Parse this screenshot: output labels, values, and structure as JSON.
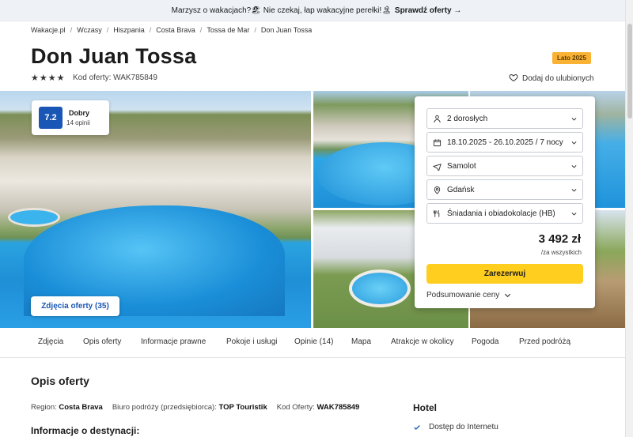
{
  "promo": {
    "text": "Marzysz o wakacjach?🏖 Nie czekaj, łap wakacyjne perełki!🏝",
    "link": "Sprawdź oferty →"
  },
  "breadcrumbs": [
    "Wakacje.pl",
    "Wczasy",
    "Hiszpania",
    "Costa Brava",
    "Tossa de Mar",
    "Don Juan Tossa"
  ],
  "offer": {
    "title": "Don Juan Tossa",
    "season_badge": "Lato 2025",
    "stars": 4,
    "code": "Kod oferty: WAK785849",
    "favorite_label": "Dodaj do ulubionych"
  },
  "rating": {
    "score": "7.2",
    "word": "Dobry",
    "count": "14 opinii"
  },
  "gallery": {
    "photos_button": "Zdjęcia oferty (35)"
  },
  "booking": {
    "guests": "2 dorosłych",
    "dates": "18.10.2025 - 26.10.2025 / 7 nocy",
    "transport": "Samolot",
    "departure": "Gdańsk",
    "board": "Śniadania i obiadokolacje (HB)",
    "price": "3 492 zł",
    "price_note": "/za wszystkich",
    "reserve_label": "Zarezerwuj",
    "summary_label": "Podsumowanie ceny"
  },
  "tabs": [
    "Zdjęcia",
    "Opis oferty",
    "Informacje prawne",
    "Pokoje i usługi",
    "Opinie (14)",
    "Mapa",
    "Atrakcje w okolicy",
    "Pogoda",
    "Przed podróżą"
  ],
  "description": {
    "title": "Opis oferty",
    "region_label": "Region:",
    "region_value": "Costa Brava",
    "agency_label": "Biuro podróży (przedsiębiorca):",
    "agency_value": "TOP Touristik",
    "code_label": "Kod Oferty:",
    "code_value": "WAK785849",
    "destination_heading": "Informacje o destynacji:"
  },
  "hotel": {
    "heading": "Hotel",
    "amenities": [
      "Dostęp do Internetu"
    ]
  },
  "colors": {
    "brand_blue": "#1a56b5",
    "reserve_yellow": "#ffce1f",
    "season_badge": "#f9b233"
  }
}
